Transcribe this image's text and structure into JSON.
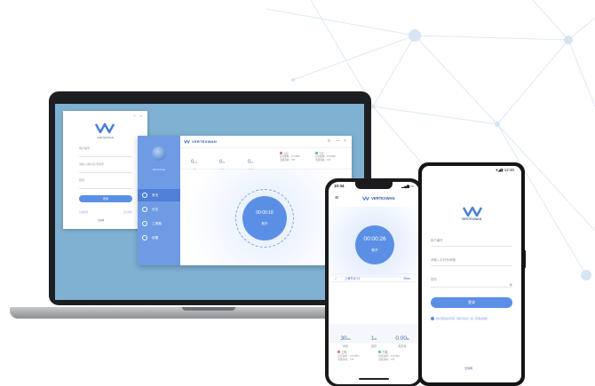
{
  "brand": {
    "name": "VERTEXWAN",
    "short": "全球网",
    "colors": {
      "primary": "#5b8fe6",
      "sidebar": "#6e9be4",
      "brandText": "#2e5aa8",
      "laptopScreen": "#7fb1d3"
    }
  },
  "login_window": {
    "brand": "VERTEXWAN",
    "fields": [
      {
        "label": "用户编号",
        "placeholder": ""
      },
      {
        "label": "请输入用户名/手机号",
        "placeholder": ""
      },
      {
        "label": "密码",
        "placeholder": ""
      }
    ],
    "login_button": "登录",
    "footer_links": [
      "记住密码",
      "忘记密码"
    ],
    "footer_logo": "全球网"
  },
  "desktop_app": {
    "title": "VERTEXWAN",
    "controls": [
      "≡",
      "—",
      "×"
    ],
    "user_name": "VertexUser",
    "menu": [
      {
        "label": "首页",
        "icon": "home-icon",
        "active": true
      },
      {
        "label": "日志",
        "icon": "log-icon",
        "active": false
      },
      {
        "label": "工具箱",
        "icon": "toolbox-icon",
        "active": false
      },
      {
        "label": "设置",
        "icon": "settings-icon",
        "active": false
      }
    ],
    "stats": [
      {
        "value": "0",
        "unit": "ms",
        "label": "时延"
      },
      {
        "value": "0",
        "unit": "%",
        "label": "丢包"
      },
      {
        "value": "0",
        "unit": "%",
        "label": "稳定性"
      }
    ],
    "network": [
      {
        "title": "上行",
        "line1": "实时速率：0.0 KB/s",
        "line2": "流量消耗：0 B",
        "color": "#e66a6a"
      },
      {
        "title": "下行",
        "line1": "实时速率：0.0 KB/s",
        "line2": "流量消耗：0 B",
        "color": "#4cbf8a"
      }
    ],
    "timer": "00:00:18",
    "timer_label": "断开"
  },
  "phone_ios": {
    "time": "10:34",
    "brand": "VERTEXWAN",
    "timer": "00:00:26",
    "timer_label": "断开",
    "node_name": "上海节点 01",
    "node_latency": "38ms",
    "stats": [
      {
        "value": "30",
        "unit": "ms",
        "label": "时延"
      },
      {
        "value": "1",
        "unit": "%",
        "label": "丢包"
      },
      {
        "value": "0.00",
        "unit": "%",
        "label": "稳定性"
      }
    ],
    "network": [
      {
        "title": "上传",
        "line1": "实时速率：0.0 KB/s",
        "line2": "流量消耗：0 B"
      },
      {
        "title": "下载",
        "line1": "实时速率：0.0 KB/s",
        "line2": "流量消耗：0 B"
      }
    ]
  },
  "phone_android": {
    "time": "12:30",
    "brand": "VERTEXWAN",
    "fields": [
      {
        "label": "用户编号"
      },
      {
        "label": "请输入手机号/邮箱"
      },
      {
        "label": "密码"
      }
    ],
    "login_button": "登录",
    "agreement": "我已阅读并同意《用户协议》和《隐私政策》",
    "footer_logo": "全球网"
  }
}
